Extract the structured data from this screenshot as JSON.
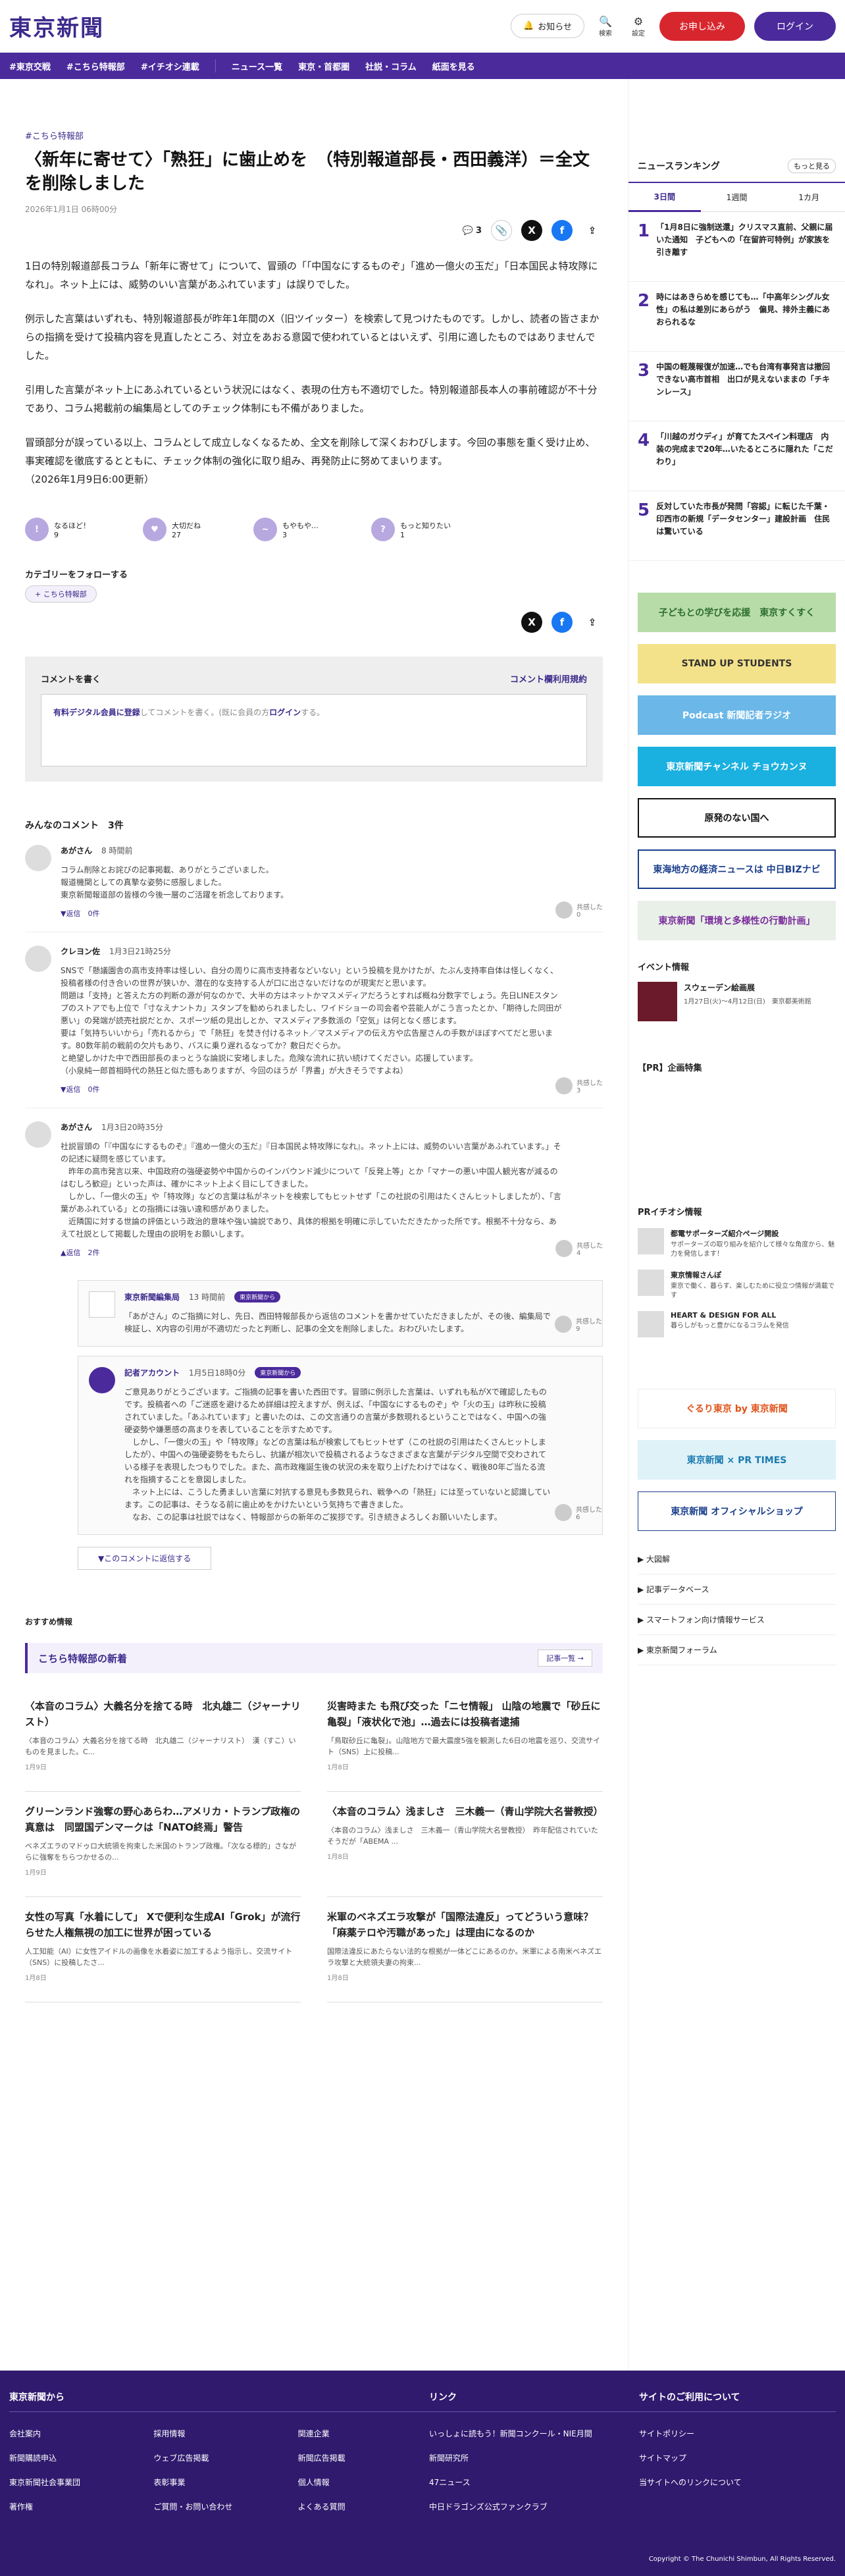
{
  "header": {
    "logo": "東京新聞",
    "notice": "お知らせ",
    "search": "検索",
    "settings": "設定",
    "register": "お申し込み",
    "login": "ログイン"
  },
  "nav": [
    "#東京交戦",
    "#こちら特報部",
    "#イチオシ連載",
    "ニュース一覧",
    "東京・首都圏",
    "社説・コラム",
    "紙面を見る"
  ],
  "article": {
    "crumb": "#こちら特報部",
    "title": "〈新年に寄せて〉「熟狂」に歯止めを　（特別報道部長・西田義洋）＝全文を削除しました",
    "date": "2026年1月1日 06時00分",
    "comment_count": "3",
    "paras": [
      "1日の特別報道部長コラム「新年に寄せて」について、冒頭の「「中国なにするものぞ」「進め一億火の玉だ」「日本国民よ特攻隊になれ」。ネット上には、威勢のいい言葉があふれています」は誤りでした。",
      "例示した言葉はいずれも、特別報道部長が昨年1年間のX（旧ツイッター）を検索して見つけたものです。しかし、読者の皆さまからの指摘を受けて投稿内容を見直したところ、対立をあおる意図で使われているとはいえず、引用に適したものではありませんでした。",
      "引用した言葉がネット上にあふれているという状況にはなく、表現の仕方も不適切でした。特別報道部長本人の事前確認が不十分であり、コラム掲載前の編集局としてのチェック体制にも不備がありました。",
      "冒頭部分が誤っている以上、コラムとして成立しなくなるため、全文を削除して深くおわびします。今回の事態を重く受け止め、事実確認を徹底するとともに、チェック体制の強化に取り組み、再発防止に努めてまいります。\n（2026年1月9日6:00更新）"
    ]
  },
  "reactions": [
    {
      "label": "なるほど！",
      "count": "9"
    },
    {
      "label": "大切だね",
      "count": "27"
    },
    {
      "label": "もやもや…",
      "count": "3"
    },
    {
      "label": "もっと知りたい",
      "count": "1"
    }
  ],
  "category": {
    "heading": "カテゴリーをフォローする",
    "tag": "+ こちら特報部"
  },
  "commentbox": {
    "title": "コメントを書く",
    "rules": "コメント欄利用規約",
    "hint_link": "有料デジタル会員に登録",
    "hint": "してコメントを書く。(既に会員の方",
    "hint_login": "ログイン",
    "hint_end": "する。"
  },
  "comments": {
    "heading": "みんなのコメント",
    "count": "3件",
    "items": [
      {
        "name": "あがさん",
        "time": "8 時間前",
        "text": "コラム削除とお詫びの記事掲載、ありがとうございました。\n報道機関としての真摯な姿勢に感服しました。\n東京新聞報道部の皆様の今後一層のご活躍を祈念しております。",
        "reply": "▼返信　0件",
        "agree": "共感した\n0"
      },
      {
        "name": "クレヨン佐",
        "time": "1月3日21時25分",
        "text": "SNSで「懸議園舎の高市支持率は怪しい、自分の周りに高市支持者などいない」という投稿を見かけたが、たぶん支持率自体は怪しくなく、投稿者様の付き合いの世界が狭いか、潜在的な支持する人が口に出さないだけなのが現実だと思います。\n問題は「支持」と答えた方の判断の源が何なのかで、大半の方はネットかマスメディアだろうとすれば概ね分数字でしょう。先日LINEスタンプのストアでも上位で「寸なえナントカ」スタンプを勧められましたし、ワイドショーの司会者や芸能人がこう言ったとか、「期待した同田が悪い」の発端が読売社説だとか、スポーツ紙の見出しとか、マスメディア多数派の「空気」は何となく感じます。\n要は「気持ちいいから」「売れるから」で「熱狂」を焚き付けるネット／マスメディアの伝え方や広告屋さんの手数がほぼすべてだと思います。80数年前の戦前の欠片もあり、バスに乗り遅れるなってか？敷日だぐらか。\nと絶望しかけた中で西田部長のまっとうな論説に安堵しました。危険な流れに抗い続けてください。応援しています。\n（小泉純一郎首相時代の熱狂と似た感もありますが、今回のほうが「界書」が大きそうですよね）",
        "reply": "▼返信　0件",
        "agree": "共感した\n3"
      },
      {
        "name": "あがさん",
        "time": "1月3日20時35分",
        "text": "社説冒頭の「『中国なにするものぞ』『進め一億火の玉だ』『日本国民よ特攻隊になれ』。ネット上には、威勢のいい言葉があふれています。」その記述に疑問を感じています。\n　昨年の高市発言以来、中国政府の強硬姿勢や中国からのインバウンド減少について「反発上等」とか「マナーの悪い中国人観光客が減るのはむしろ歓迎」といった声は、確かにネット上よく目にしてきました。\n　しかし、「一億火の玉」や「特攻隊」などの言葉は私がネットを検索してもヒットせず「この社説の引用はたくさんヒットしましたが）、「言葉があふれている」との指摘には強い違和感がありました。\n　近隣国に対する世論の評価という政治的意味や強い論説であり、具体的根拠を明確に示していただきたかった所です。根拠不十分なら、あえて社説として掲載した理由の説明をお願いします。",
        "reply": "▲返信　2件",
        "agree": "共感した\n4"
      }
    ]
  },
  "replies": [
    {
      "name": "東京新聞編集局",
      "time": "13 時間前",
      "badge": "東京新聞から",
      "text": "「あがさん」のご指摘に対し、先日、西田特報部長から返信のコメントを書かせていただきましたが、その後、編集局で検証し、X内容の引用が不適切だったと判断し、記事の全文を削除しました。おわびいたします。",
      "agree": "共感した\n9"
    },
    {
      "name": "記者アカウント",
      "time": "1月5日18時0分",
      "badge": "東京新聞から",
      "text": "ご意見ありがとうございます。ご指摘の記事を書いた西田です。冒頭に例示した言葉は、いずれも私がXで確認したものです。投稿者への「ご迷惑を避けるため詳細は控えますが、例えば、「中国なにするものぞ」や「火の玉」は昨秋に投稿されていました。「あふれています」と書いたのは、この文言通りの言葉が多数現れるということではなく、中国への強硬姿勢や嫌悪感の高まりを表していることを示すためです。\n　しかし、「一億火の玉」や「特攻隊」などの言葉は私が検索してもヒットせず（この社説の引用はたくさんヒットしましたが）、中国への強硬姿勢をもたらし、抗議が相次いで投稿されるようなさまざまな言葉がデジタル空間で交わされている様子を表現したつもりでした。また、高市政権誕生後の状況の未を取り上げたわけではなく、戦後80年ご当たる流れを指摘することを意図しました。\n　ネット上には、こうした勇ましい言葉に対抗する意見も多数見られ、戦争への「熱狂」には至っていないと認識しています。この記事は、そうなる前に歯止めをかけたいという気持ちで書きました。\n　なお、この記事は社説ではなく、特報部からの新年のご挨拶です。引き続きよろしくお願いいたします。",
      "agree": "共感した\n6"
    }
  ],
  "replybutton": "▼このコメントに返信する",
  "recommend": {
    "label": "おすすめ情報",
    "section": "こちら特報部の新着",
    "more": "記事一覧 →",
    "items": [
      {
        "t": "〈本音のコラム〉大義名分を捨てる時　北丸雄二（ジャーナリスト）",
        "s": "〈本音のコラム〉大義名分を捨てる時　北丸雄二（ジャーナリスト）　漢（すこ）いものを見ました。C...",
        "d": "1月9日"
      },
      {
        "t": "災害時また も飛び交った「ニセ情報」 山陰の地震で「砂丘に亀裂」「液状化で池」…過去には投稿者逮捕",
        "s": "「鳥取砂丘に亀裂」。山陰地方で最大震度5強を観測した6日の地震を巡り、交流サイト（SNS）上に投稿...",
        "d": "1月8日"
      },
      {
        "t": "グリーンランド強奪の野心あらわ…アメリカ・トランプ政権の真意は　同盟国デンマークは「NATO終焉」警告",
        "s": "ベネズエラのマドゥロ大統領を拘束した米国のトランプ政権。「次なる標的」さながらに強奪をちらつかせるの...",
        "d": "1月9日"
      },
      {
        "t": "〈本音のコラム〉浅ましさ　三木義一（青山学院大名誉教授）",
        "s": "〈本音のコラム〉浅ましさ　三木義一（青山学院大名誉教授）　昨年配信されていたそうだが「ABEMA ...",
        "d": "1月8日"
      },
      {
        "t": "女性の写真「水着にして」 Xで便利な生成AI「Grok」が流行らせた人権無視の加工に世界が困っている",
        "s": "人工知能（AI）に女性アイドルの画像を水着姿に加工するよう指示し、交流サイト（SNS）に投稿したさ...",
        "d": "1月8日"
      },
      {
        "t": "米軍のベネズエラ攻撃が「国際法違反」ってどういう意味？　「麻薬テロや汚職があった」は理由になるのか",
        "s": "国際法違反にあたらない法的な根拠が一体どこにあるのか。米軍による南米ベネズエラ攻撃と大統領夫妻の拘束...",
        "d": "1月8日"
      }
    ]
  },
  "sidebar": {
    "ranking_title": "ニュースランキング",
    "ranking_more": "もっと見る",
    "tabs": [
      "3日間",
      "1週間",
      "1カ月"
    ],
    "ranking": [
      {
        "n": "1",
        "t": "「1月8日に強制送還」クリスマス直前、父親に届いた通知　子どもへの「在留許可特例」が家族を引き離す"
      },
      {
        "n": "2",
        "t": "時にはあきらめを感じても…「中高年シングル女性」の私は差別にあらがう　偏見、排外主義にあおられるな"
      },
      {
        "n": "3",
        "t": "中国の軽蔑報復が加速…でも台湾有事発言は撤回できない高市首相　出口が見えないままの「チキンレース」"
      },
      {
        "n": "4",
        "t": "「川越のガウディ」が育てたスペイン料理店　内装の完成まで20年…いたるところに隠れた「こだわり」"
      },
      {
        "n": "5",
        "t": "反対していた市長が発問「容認」に転じた千葉・印西市の新規「データセンター」建設計画　住民は驚いている"
      }
    ],
    "banners": [
      {
        "t": "子どもとの学びを応援　東京すくすく",
        "bg": "#b7dca8",
        "c": "#2d6e2d"
      },
      {
        "t": "STAND UP STUDENTS",
        "bg": "#f4e28a",
        "c": "#333"
      },
      {
        "t": "Podcast 新聞記者ラジオ",
        "bg": "#6ab7e8",
        "c": "#fff"
      },
      {
        "t": "東京新聞チャンネル チョウカンヌ",
        "bg": "#1ab0e0",
        "c": "#fff"
      },
      {
        "t": "原発のない国へ",
        "bg": "#ffffff",
        "c": "#111"
      },
      {
        "t": "東海地方の経済ニュースは 中日BIZナビ",
        "bg": "#ffffff",
        "c": "#1a3e8c"
      },
      {
        "t": "東京新聞「環境と多様性の行動計画」",
        "bg": "#e8f0e8",
        "c": "#7a2a9c"
      }
    ],
    "event_title": "イベント情報",
    "event": {
      "t": "スウェーデン絵画展",
      "s": "1月27日(火)〜4月12日(日)　東京都美術館"
    },
    "pr_title": "【PR】企画特集",
    "pr2_title": "PRイチオシ情報",
    "pr": [
      {
        "t": "都電サポーターズ紹介ページ開設",
        "s": "サポーターズの取り組みを紹介して様々な角度から、魅力を発信します！"
      },
      {
        "t": "東京情報さんぽ",
        "s": "東京で働く、暮らす、楽しむために役立つ情報が満載です"
      },
      {
        "t": "HEART & DESIGN FOR ALL",
        "s": "暮らしがもっと豊かになるコラムを発信"
      }
    ],
    "banners2": [
      {
        "t": "ぐるり東京 by 東京新聞",
        "bg": "#ffffff",
        "c": "#e0531a"
      },
      {
        "t": "東京新聞 × PR TIMES",
        "bg": "#dff2f8",
        "c": "#1a7ab0"
      },
      {
        "t": "東京新聞 オフィシャルショップ",
        "bg": "#ffffff",
        "c": "#1a3e8c"
      }
    ],
    "links": [
      "大図解",
      "記事データベース",
      "スマートフォン向け情報サービス",
      "東京新聞フォーラム"
    ]
  },
  "footer": {
    "col1": "東京新聞から",
    "col2": "リンク",
    "col3": "サイトのご利用について",
    "links1": [
      "会社案内",
      "採用情報",
      "関連企業",
      "新聞購読申込",
      "ウェブ広告掲載",
      "新聞広告掲載",
      "東京新聞社会事業団",
      "表彰事業",
      "個人情報",
      "著作権",
      "ご質問・お問い合わせ",
      "よくある質問"
    ],
    "links2": [
      "いっしょに読もう！新聞コンクール・NIE月間",
      "新聞研究所",
      "47ニュース",
      "中日ドラゴンズ公式ファンクラブ"
    ],
    "links3": [
      "サイトポリシー",
      "サイトマップ",
      "当サイトへのリンクについて"
    ],
    "copyright": "Copyright © The Chunichi Shimbun, All Rights Reserved."
  }
}
